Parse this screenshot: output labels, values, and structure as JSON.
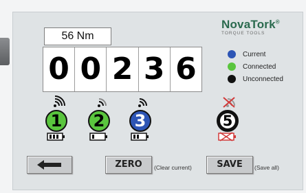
{
  "brand": {
    "name": "NovaTork",
    "mark": "®",
    "tagline": "TORQUE TOOLS"
  },
  "torque": {
    "value": "56 Nm"
  },
  "counter": {
    "digits": [
      "0",
      "0",
      "2",
      "3",
      "6"
    ]
  },
  "legend": [
    {
      "label": "Current",
      "color": "#2d55b5"
    },
    {
      "label": "Connected",
      "color": "#5ac53e"
    },
    {
      "label": "Unconnected",
      "color": "#111111"
    }
  ],
  "tools": [
    {
      "number": "1",
      "status": "connected",
      "battery_bars": 3
    },
    {
      "number": "2",
      "status": "connected",
      "battery_bars": 1
    },
    {
      "number": "3",
      "status": "current",
      "battery_bars": 2
    },
    {
      "number": "5",
      "status": "unconnected",
      "battery_bars": 0
    }
  ],
  "buttons": {
    "back_icon": "arrow-left-icon",
    "zero_label": "ZERO",
    "zero_hint": "(Clear current)",
    "save_label": "SAVE",
    "save_hint": "(Save all)"
  }
}
